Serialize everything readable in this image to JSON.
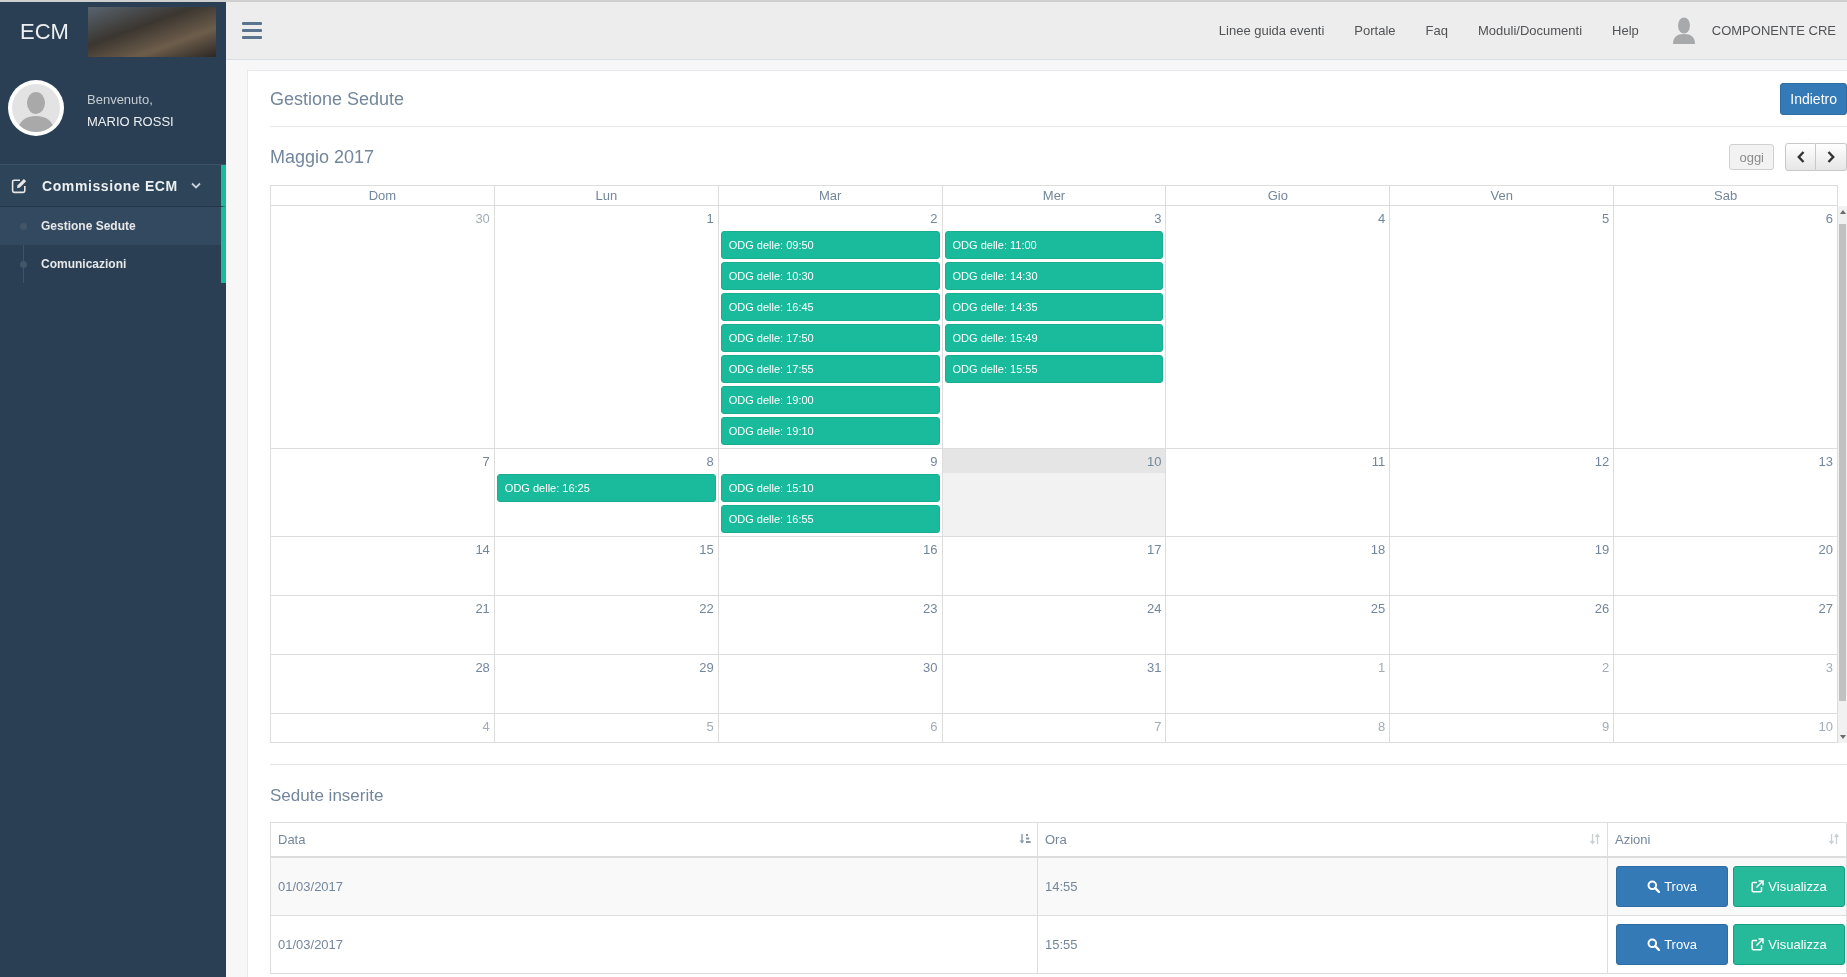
{
  "sidebar": {
    "logo": "ECM",
    "welcome": "Benvenuto,",
    "user_name": "MARIO ROSSI",
    "menu": [
      {
        "label": "Commissione ECM",
        "selected": true,
        "expanded": true,
        "children": [
          {
            "label": "Gestione Sedute",
            "selected": true
          },
          {
            "label": "Comunicazioni",
            "selected": false
          }
        ]
      }
    ]
  },
  "top_bar": {
    "links": [
      "Linee guida eventi",
      "Portale",
      "Faq",
      "Moduli/Documenti",
      "Help"
    ],
    "user_name": "COMPONENTE CRE"
  },
  "page": {
    "title": "Gestione Sedute",
    "back_button": "Indietro"
  },
  "calendar": {
    "title": "Maggio 2017",
    "today_button": {
      "label": "oggi",
      "disabled": true
    },
    "weekdays": [
      "Dom",
      "Lun",
      "Mar",
      "Mer",
      "Gio",
      "Ven",
      "Sab"
    ],
    "weeks": [
      {
        "days": [
          {
            "day": "30",
            "other_month": true,
            "today": false
          },
          {
            "day": "1",
            "other_month": false,
            "today": false
          },
          {
            "day": "2",
            "other_month": false,
            "today": false,
            "events": [
              "ODG delle: 09:50",
              "ODG delle: 10:30",
              "ODG delle: 16:45",
              "ODG delle: 17:50",
              "ODG delle: 17:55",
              "ODG delle: 19:00",
              "ODG delle: 19:10"
            ]
          },
          {
            "day": "3",
            "other_month": false,
            "today": false,
            "events": [
              "ODG delle: 11:00",
              "ODG delle: 14:30",
              "ODG delle: 14:35",
              "ODG delle: 15:49",
              "ODG delle: 15:55"
            ]
          },
          {
            "day": "4",
            "other_month": false,
            "today": false
          },
          {
            "day": "5",
            "other_month": false,
            "today": false
          },
          {
            "day": "6",
            "other_month": false,
            "today": false
          }
        ]
      },
      {
        "days": [
          {
            "day": "7",
            "other_month": false,
            "today": false
          },
          {
            "day": "8",
            "other_month": false,
            "today": false,
            "events": [
              "ODG delle: 16:25"
            ]
          },
          {
            "day": "9",
            "other_month": false,
            "today": false,
            "events": [
              "ODG delle: 15:10",
              "ODG delle: 16:55"
            ]
          },
          {
            "day": "10",
            "other_month": false,
            "today": true
          },
          {
            "day": "11",
            "other_month": false,
            "today": false
          },
          {
            "day": "12",
            "other_month": false,
            "today": false
          },
          {
            "day": "13",
            "other_month": false,
            "today": false
          }
        ]
      },
      {
        "days": [
          {
            "day": "14",
            "other_month": false,
            "today": false
          },
          {
            "day": "15",
            "other_month": false,
            "today": false
          },
          {
            "day": "16",
            "other_month": false,
            "today": false
          },
          {
            "day": "17",
            "other_month": false,
            "today": false
          },
          {
            "day": "18",
            "other_month": false,
            "today": false
          },
          {
            "day": "19",
            "other_month": false,
            "today": false
          },
          {
            "day": "20",
            "other_month": false,
            "today": false
          }
        ]
      },
      {
        "days": [
          {
            "day": "21",
            "other_month": false,
            "today": false
          },
          {
            "day": "22",
            "other_month": false,
            "today": false
          },
          {
            "day": "23",
            "other_month": false,
            "today": false
          },
          {
            "day": "24",
            "other_month": false,
            "today": false
          },
          {
            "day": "25",
            "other_month": false,
            "today": false
          },
          {
            "day": "26",
            "other_month": false,
            "today": false
          },
          {
            "day": "27",
            "other_month": false,
            "today": false
          }
        ]
      },
      {
        "days": [
          {
            "day": "28",
            "other_month": false,
            "today": false
          },
          {
            "day": "29",
            "other_month": false,
            "today": false
          },
          {
            "day": "30",
            "other_month": false,
            "today": false
          },
          {
            "day": "31",
            "other_month": false,
            "today": false
          },
          {
            "day": "1",
            "other_month": true,
            "today": false
          },
          {
            "day": "2",
            "other_month": true,
            "today": false
          },
          {
            "day": "3",
            "other_month": true,
            "today": false
          }
        ]
      },
      {
        "days": [
          {
            "day": "4",
            "other_month": true,
            "today": false
          },
          {
            "day": "5",
            "other_month": true,
            "today": false
          },
          {
            "day": "6",
            "other_month": true,
            "today": false
          },
          {
            "day": "7",
            "other_month": true,
            "today": false
          },
          {
            "day": "8",
            "other_month": true,
            "today": false
          },
          {
            "day": "9",
            "other_month": true,
            "today": false
          },
          {
            "day": "10",
            "other_month": true,
            "today": false
          }
        ]
      }
    ]
  },
  "sessions": {
    "title": "Sedute inserite",
    "columns": [
      {
        "label": "Data",
        "sorted": true
      },
      {
        "label": "Ora",
        "sorted": false
      },
      {
        "label": "Azioni",
        "sorted": false
      }
    ],
    "rows": [
      {
        "date": "01/03/2017",
        "time": "14:55",
        "actions": [
          {
            "kind": "find",
            "label": "Trova"
          },
          {
            "kind": "view",
            "label": "Visualizza"
          }
        ]
      },
      {
        "date": "01/03/2017",
        "time": "15:55",
        "actions": [
          {
            "kind": "find",
            "label": "Trova"
          },
          {
            "kind": "view",
            "label": "Visualizza"
          }
        ]
      }
    ]
  }
}
